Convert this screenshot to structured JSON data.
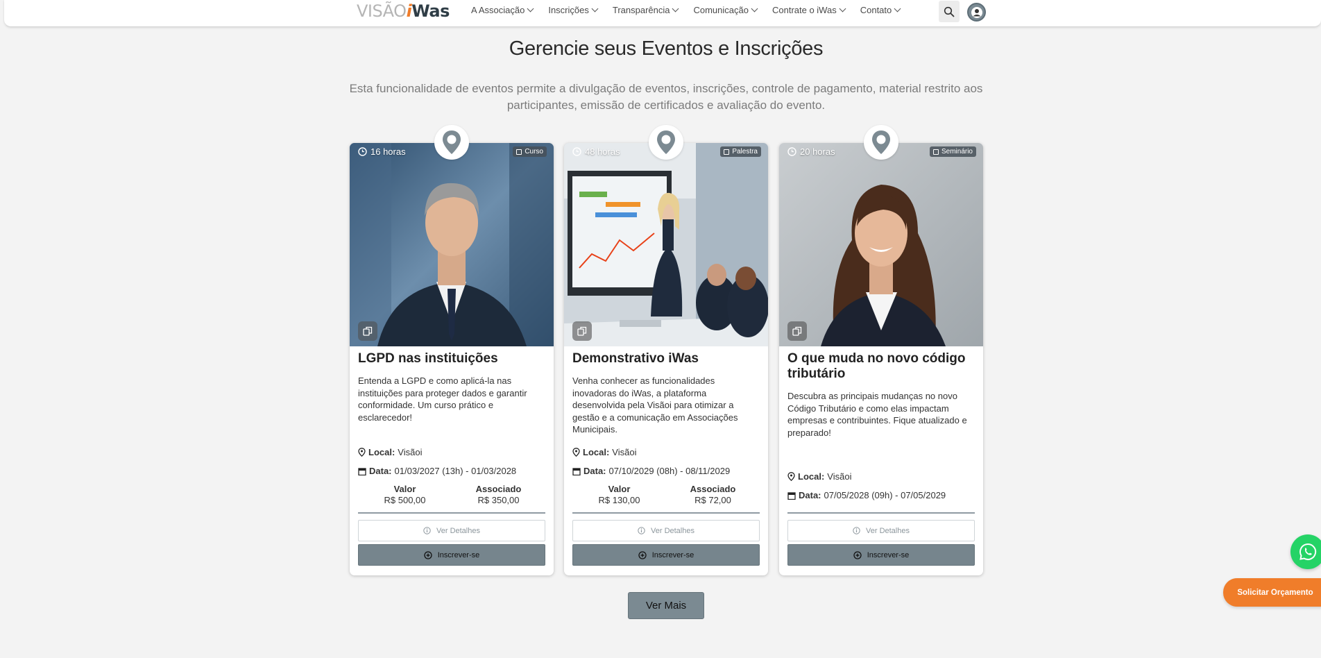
{
  "header": {
    "logo_part1": "VISÃO",
    "logo_part2": "i",
    "logo_part3": "Was",
    "nav": [
      {
        "label": "A Associação"
      },
      {
        "label": "Inscrições"
      },
      {
        "label": "Transparência"
      },
      {
        "label": "Comunicação"
      },
      {
        "label": "Contrate o iWas"
      },
      {
        "label": "Contato"
      }
    ]
  },
  "hero": {
    "title": "Gerencie seus Eventos e Inscrições",
    "subtitle": "Esta funcionalidade de eventos permite a divulgação de eventos, inscrições, controle de pagamento, material restrito aos participantes, emissão de certificados e avaliação do evento."
  },
  "labels": {
    "local": "Local:",
    "data": "Data:",
    "valor": "Valor",
    "associado": "Associado",
    "details_button": "Ver Detalhes",
    "subscribe_button": "Inscrever-se"
  },
  "cards": [
    {
      "duration": "16 horas",
      "type": "Curso",
      "title": "LGPD nas instituições",
      "description": "Entenda a LGPD e como aplicá-la nas instituições para proteger dados e garantir conformidade. Um curso prático e esclarecedor!",
      "local": "Visãoi",
      "date": "01/03/2027 (13h) - 01/03/2028",
      "price": "R$ 500,00",
      "member_price": "R$ 350,00"
    },
    {
      "duration": "48 horas",
      "type": "Palestra",
      "title": "Demonstrativo iWas",
      "description": "Venha conhecer as funcionalidades inovadoras do iWas, a plataforma desenvolvida pela Visãoi para otimizar a gestão e a comunicação em Associações Municipais.",
      "local": "Visãoi",
      "date": "07/10/2029 (08h) - 08/11/2029",
      "price": "R$ 130,00",
      "member_price": "R$ 72,00"
    },
    {
      "duration": "20 horas",
      "type": "Seminário",
      "title": "O que muda no novo código tributário",
      "description": "Descubra as principais mudanças no novo Código Tributário e como elas impactam empresas e contribuintes. Fique atualizado e preparado!",
      "local": "Visãoi",
      "date": "07/05/2028 (09h) - 07/05/2029"
    }
  ],
  "more_button": "Ver Mais",
  "quote_button": "Solicitar Orçamento",
  "colors": {
    "brand_orange": "#f07d2a",
    "button_gray": "#76858d",
    "whatsapp_green": "#25d366"
  }
}
